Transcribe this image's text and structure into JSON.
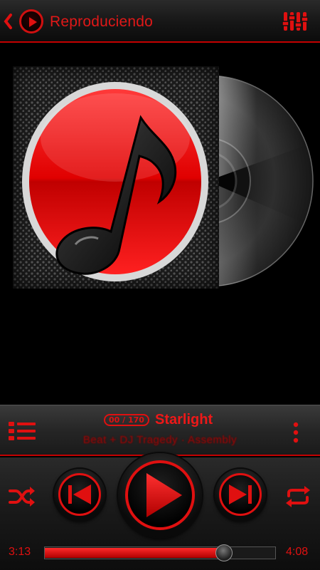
{
  "header": {
    "title": "Reproduciendo",
    "back_icon": "chevron-left-icon",
    "app_icon": "play-circle-icon",
    "equalizer_icon": "equalizer-icon"
  },
  "album_art": {
    "icon": "music-note-icon",
    "disc_icon": "vinyl-disc-icon"
  },
  "track": {
    "counter": "00 / 170",
    "title": "Starlight",
    "artist": "Beat + DJ Tragedy · Assembly"
  },
  "info_bar": {
    "playlist_icon": "playlist-icon",
    "menu_icon": "more-vert-icon"
  },
  "controls": {
    "shuffle_icon": "shuffle-icon",
    "prev_icon": "skip-previous-icon",
    "play_icon": "play-icon",
    "next_icon": "skip-next-icon",
    "repeat_icon": "repeat-icon"
  },
  "progress": {
    "elapsed": "3:13",
    "total": "4:08",
    "fraction": 0.7782
  },
  "colors": {
    "accent": "#e01010",
    "background": "#000000",
    "bar": "#262626"
  }
}
